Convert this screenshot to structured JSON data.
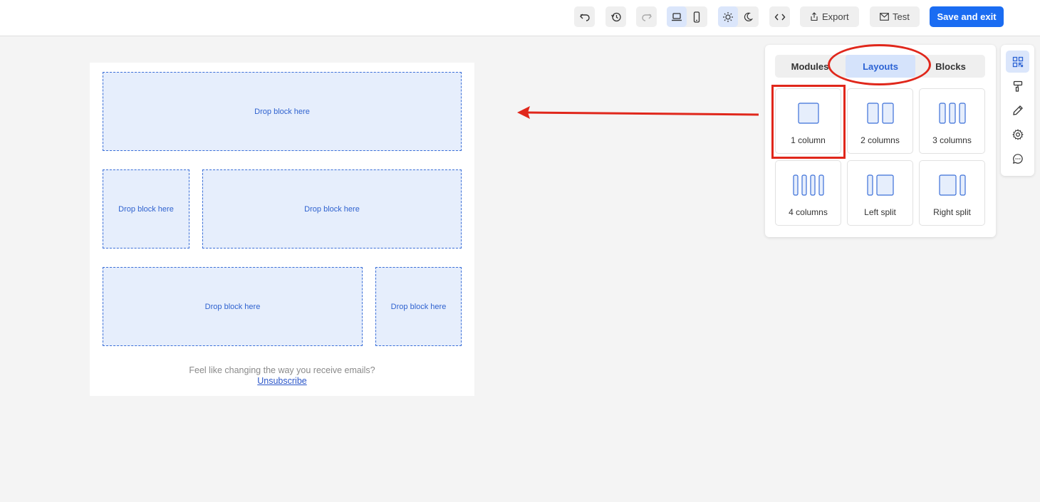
{
  "toolbar": {
    "undo_icon": "undo-icon",
    "history_icon": "history-icon",
    "redo_icon": "redo-icon",
    "desktop_icon": "laptop-icon",
    "mobile_icon": "phone-icon",
    "light_icon": "sun-icon",
    "dark_icon": "moon-icon",
    "code_icon": "code-icon",
    "export_label": "Export",
    "test_label": "Test",
    "save_label": "Save and exit",
    "accent": "#1a6cf2"
  },
  "email": {
    "rows": [
      {
        "cells": [
          {
            "label": "Drop block here"
          }
        ]
      },
      {
        "cells": [
          {
            "label": "Drop block here"
          },
          {
            "label": "Drop block here"
          }
        ]
      },
      {
        "cells": [
          {
            "label": "Drop block here"
          },
          {
            "label": "Drop block here"
          }
        ]
      }
    ],
    "footer_text": "Feel like changing the way you receive emails?",
    "unsubscribe": "Unsubscribe"
  },
  "panel": {
    "tabs": [
      {
        "label": "Modules"
      },
      {
        "label": "Layouts",
        "active": true
      },
      {
        "label": "Blocks"
      }
    ],
    "layouts": [
      {
        "label": "1 column"
      },
      {
        "label": "2 columns"
      },
      {
        "label": "3 columns"
      },
      {
        "label": "4 columns"
      },
      {
        "label": "Left split"
      },
      {
        "label": "Right split"
      }
    ]
  },
  "rail": [
    "grid-icon",
    "paint-roller-icon",
    "pencil-icon",
    "gear-icon",
    "chat-icon"
  ],
  "annotation_color": "#e0271b"
}
